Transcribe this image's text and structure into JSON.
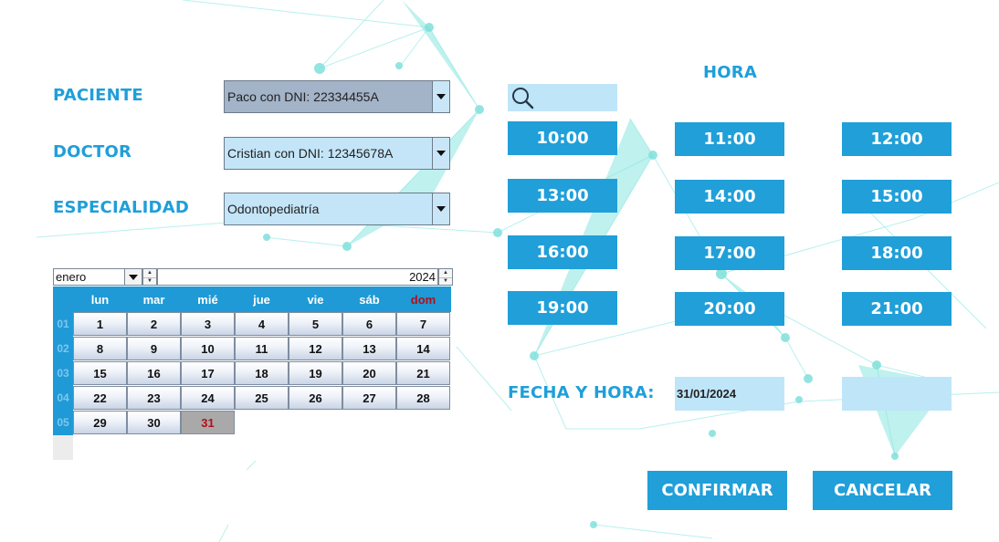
{
  "form": {
    "paciente_label": "PACIENTE",
    "doctor_label": "DOCTOR",
    "especialidad_label": "ESPECIALIDAD",
    "paciente_value": "Paco con DNI: 22334455A",
    "doctor_value": "Cristian con DNI: 12345678A",
    "especialidad_value": "Odontopediatría"
  },
  "calendar": {
    "month": "enero",
    "year": "2024",
    "weekdays": [
      "lun",
      "mar",
      "mié",
      "jue",
      "vie",
      "sáb",
      "dom"
    ],
    "weeks": [
      "01",
      "02",
      "03",
      "04",
      "05"
    ],
    "days": [
      [
        "1",
        "2",
        "3",
        "4",
        "5",
        "6",
        "7"
      ],
      [
        "8",
        "9",
        "10",
        "11",
        "12",
        "13",
        "14"
      ],
      [
        "15",
        "16",
        "17",
        "18",
        "19",
        "20",
        "21"
      ],
      [
        "22",
        "23",
        "24",
        "25",
        "26",
        "27",
        "28"
      ],
      [
        "29",
        "30",
        "31"
      ]
    ],
    "selected_day": "31"
  },
  "hora": {
    "title": "HORA",
    "search_value": "",
    "times": [
      "10:00",
      "11:00",
      "12:00",
      "13:00",
      "14:00",
      "15:00",
      "16:00",
      "17:00",
      "18:00",
      "19:00",
      "20:00",
      "21:00"
    ]
  },
  "fecha_hora": {
    "label": "FECHA Y HORA:",
    "date_value": "31/01/2024",
    "time_value": ""
  },
  "actions": {
    "confirm_label": "CONFIRMAR",
    "cancel_label": "CANCELAR"
  },
  "colors": {
    "accent": "#209fd9",
    "field_bg": "#c4e5f8",
    "selected_field_bg": "#a3b3c8",
    "sunday_red": "#b0101a",
    "network_lines": "#7fe3de"
  },
  "icons": {
    "search": "search-icon",
    "dropdown": "chevron-down-icon"
  }
}
